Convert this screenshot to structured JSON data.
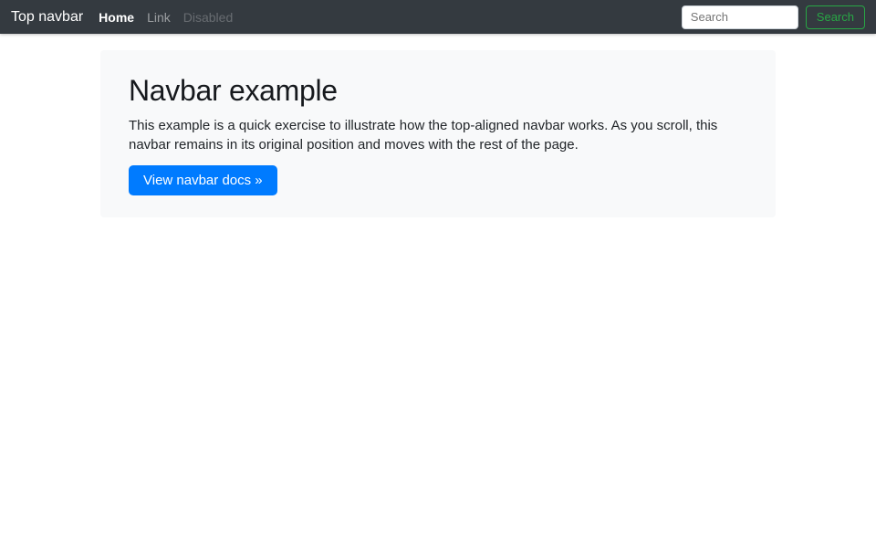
{
  "navbar": {
    "brand": "Top navbar",
    "links": [
      {
        "label": "Home",
        "state": "active"
      },
      {
        "label": "Link",
        "state": "default"
      },
      {
        "label": "Disabled",
        "state": "disabled"
      }
    ],
    "search": {
      "placeholder": "Search",
      "button_label": "Search"
    }
  },
  "jumbotron": {
    "title": "Navbar example",
    "description": "This example is a quick exercise to illustrate how the top-aligned navbar works. As you scroll, this navbar remains in its original position and moves with the rest of the page.",
    "cta_label": "View navbar docs »"
  },
  "colors": {
    "navbar_bg": "#343a40",
    "jumbotron_bg": "#f8f9fa",
    "primary_blue": "#007bff",
    "success_green": "#28a745",
    "text_dark": "#212529"
  }
}
